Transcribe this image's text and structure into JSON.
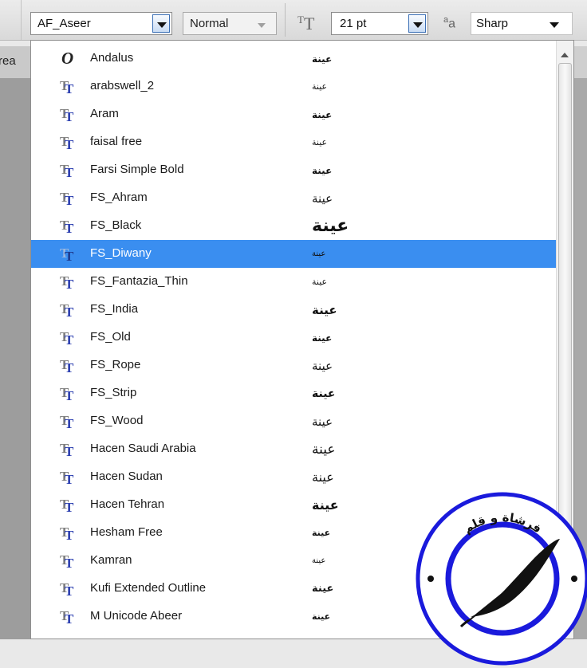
{
  "toolbar": {
    "font_family": "AF_Aseer",
    "font_style": "Normal",
    "font_size": "21 pt",
    "size_icon": "font-size-icon",
    "antialias_icon": "anti-alias-icon",
    "antialias_value": "Sharp"
  },
  "background": {
    "partial_tab_text": "rea"
  },
  "font_list": {
    "selected_index": 7,
    "selected_color": "#3a8ef0",
    "items": [
      {
        "name": "Andalus",
        "icon": "opentype-icon",
        "sample": "عينة"
      },
      {
        "name": "arabswell_2",
        "icon": "truetype-icon",
        "sample": "عينة"
      },
      {
        "name": "Aram",
        "icon": "truetype-icon",
        "sample": "عينة"
      },
      {
        "name": "faisal free",
        "icon": "truetype-icon",
        "sample": "عينة"
      },
      {
        "name": "Farsi Simple Bold",
        "icon": "truetype-icon",
        "sample": "عينة"
      },
      {
        "name": "FS_Ahram",
        "icon": "truetype-icon",
        "sample": "عينة"
      },
      {
        "name": "FS_Black",
        "icon": "truetype-icon",
        "sample": "عينة"
      },
      {
        "name": "FS_Diwany",
        "icon": "truetype-icon",
        "sample": "عينة"
      },
      {
        "name": "FS_Fantazia_Thin",
        "icon": "truetype-icon",
        "sample": "عينة"
      },
      {
        "name": "FS_India",
        "icon": "truetype-icon",
        "sample": "عينة"
      },
      {
        "name": "FS_Old",
        "icon": "truetype-icon",
        "sample": "عينة"
      },
      {
        "name": "FS_Rope",
        "icon": "truetype-icon",
        "sample": "عينة"
      },
      {
        "name": "FS_Strip",
        "icon": "truetype-icon",
        "sample": "عينة"
      },
      {
        "name": "FS_Wood",
        "icon": "truetype-icon",
        "sample": "عينة"
      },
      {
        "name": "Hacen Saudi Arabia",
        "icon": "truetype-icon",
        "sample": "عينة"
      },
      {
        "name": "Hacen Sudan",
        "icon": "truetype-icon",
        "sample": "عينة"
      },
      {
        "name": "Hacen Tehran",
        "icon": "truetype-icon",
        "sample": "عينة"
      },
      {
        "name": "Hesham Free",
        "icon": "truetype-icon",
        "sample": "عينة"
      },
      {
        "name": "Kamran",
        "icon": "truetype-icon",
        "sample": "عينة"
      },
      {
        "name": "Kufi Extended Outline",
        "icon": "truetype-icon",
        "sample": "عينة"
      },
      {
        "name": "M Unicode Abeer",
        "icon": "truetype-icon",
        "sample": "عينة"
      }
    ]
  },
  "watermark": {
    "text": "فرشاة و قلم",
    "icon": "feather-icon",
    "color": "#1a1adc"
  }
}
